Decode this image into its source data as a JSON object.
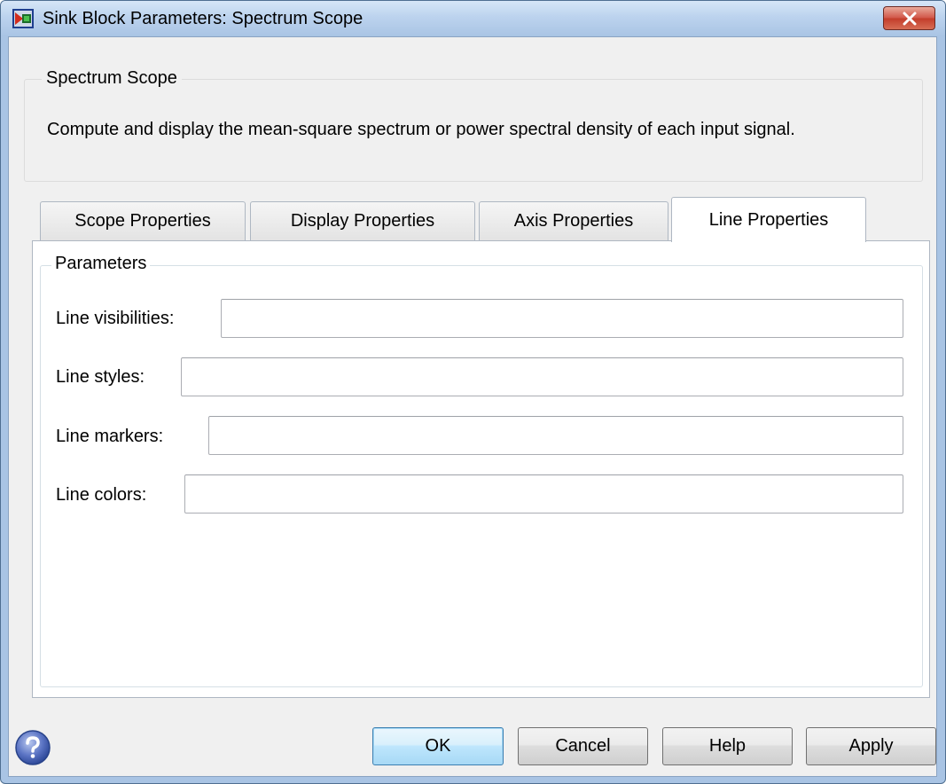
{
  "window": {
    "title": "Sink Block Parameters: Spectrum Scope"
  },
  "description": {
    "group_label": "Spectrum Scope",
    "text": "Compute and display the mean-square spectrum or power spectral density of each input signal."
  },
  "tabs": [
    {
      "label": "Scope Properties",
      "active": false
    },
    {
      "label": "Display Properties",
      "active": false
    },
    {
      "label": "Axis Properties",
      "active": false
    },
    {
      "label": "Line Properties",
      "active": true
    }
  ],
  "parameters": {
    "group_label": "Parameters",
    "fields": [
      {
        "label": "Line visibilities:",
        "value": ""
      },
      {
        "label": "Line styles:",
        "value": ""
      },
      {
        "label": "Line markers:",
        "value": ""
      },
      {
        "label": "Line colors:",
        "value": ""
      }
    ]
  },
  "buttons": {
    "ok": "OK",
    "cancel": "Cancel",
    "help": "Help",
    "apply": "Apply"
  },
  "icons": {
    "app": "simulink-block-icon",
    "close": "close-icon",
    "help": "help-question-icon"
  },
  "colors": {
    "titlebar": "#bcd3ee",
    "close_button": "#c33d2b",
    "dialog_background": "#f0f0f0",
    "default_button": "#bee6fd"
  }
}
